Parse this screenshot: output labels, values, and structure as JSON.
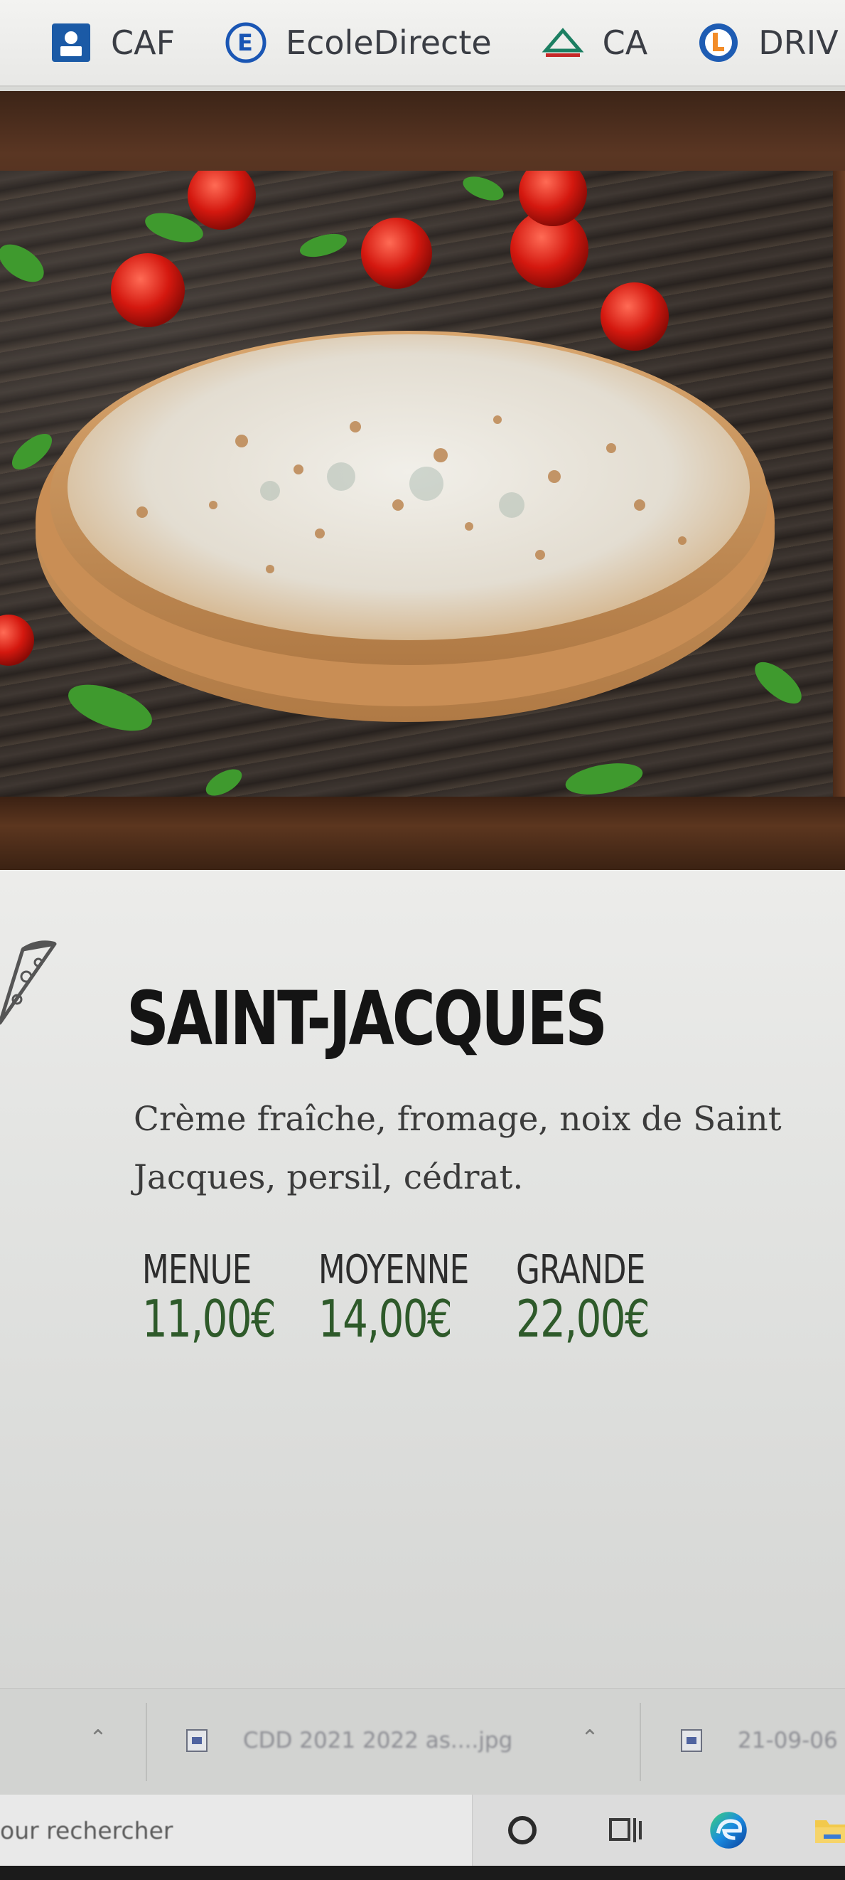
{
  "bookmarks": [
    {
      "label": "CAF",
      "icon": "caf-icon"
    },
    {
      "label": "EcoleDirecte",
      "icon": "ecoledirecte-icon"
    },
    {
      "label": "CA",
      "icon": "credit-agricole-icon"
    },
    {
      "label": "DRIV",
      "icon": "leclerc-icon"
    }
  ],
  "product": {
    "name": "SAINT-JACQUES",
    "description": "Crème fraîche, fromage, noix de Saint Jacques, persil, cédrat.",
    "sizes": [
      {
        "label": "MENUE",
        "price": "11,00€"
      },
      {
        "label": "MOYENNE",
        "price": "14,00€"
      },
      {
        "label": "GRANDE",
        "price": "22,00€"
      }
    ],
    "price_color": "#2e5a2a"
  },
  "downloads": [
    {
      "name": "CDD 2021 2022 as....jpg"
    },
    {
      "name": "21-09-06"
    }
  ],
  "taskbar": {
    "search_placeholder": "our rechercher"
  }
}
